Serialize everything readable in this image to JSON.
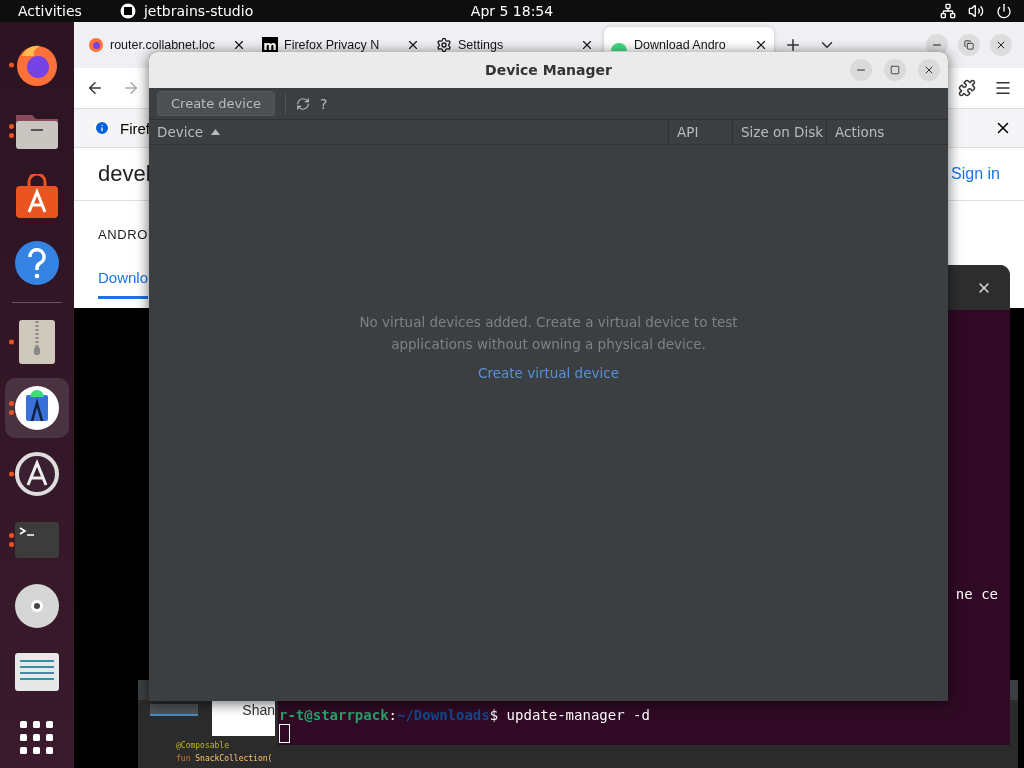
{
  "top_bar": {
    "activities": "Activities",
    "app_name": "jetbrains-studio",
    "clock": "Apr 5  18:54"
  },
  "dock": {
    "pinned": [
      {
        "kind": "firefox",
        "running": true,
        "multiple": false,
        "selected": false
      },
      {
        "kind": "files",
        "running": true,
        "multiple": true,
        "selected": false
      },
      {
        "kind": "store",
        "running": false,
        "multiple": false,
        "selected": false
      },
      {
        "kind": "help",
        "running": false,
        "multiple": false,
        "selected": false
      }
    ],
    "running": [
      {
        "kind": "archive",
        "running": true,
        "multiple": false,
        "selected": false
      },
      {
        "kind": "studio",
        "running": true,
        "multiple": true,
        "selected": true
      },
      {
        "kind": "updater",
        "running": true,
        "multiple": false,
        "selected": false
      },
      {
        "kind": "terminal",
        "running": true,
        "multiple": true,
        "selected": false
      },
      {
        "kind": "disc",
        "running": false,
        "multiple": false,
        "selected": false
      },
      {
        "kind": "editor",
        "running": false,
        "multiple": false,
        "selected": false
      }
    ]
  },
  "browser": {
    "tabs": [
      {
        "kind": "page",
        "label": "router.collabnet.loc",
        "selected": false
      },
      {
        "kind": "letter",
        "badge": "m",
        "label": "Firefox Privacy N",
        "selected": false
      },
      {
        "kind": "gear",
        "label": "Settings",
        "selected": false
      },
      {
        "kind": "android",
        "label": "Download Andro",
        "selected": true
      }
    ],
    "notice": "Firef",
    "page": {
      "logo": "devel",
      "sign_in": "Sign in",
      "heading": "ANDRO",
      "nav_link": "Downlo"
    }
  },
  "terminal": {
    "fragment": "ne ce",
    "prompt": "r-t@starrpack",
    "colon": ":",
    "path": "~/Downloads",
    "command": "$ update-manager -d"
  },
  "studio": {
    "preview": "Shan",
    "code": [
      {
        "kind": "annotation",
        "text": "@Composable"
      },
      {
        "kind": "function",
        "keyword": "fun",
        "text": "SnackCollection("
      }
    ]
  },
  "device_manager": {
    "title": "Device Manager",
    "create_button": "Create device",
    "help": "?",
    "columns": [
      {
        "label": "Device",
        "sorted": true
      },
      {
        "label": "API",
        "sorted": false
      },
      {
        "label": "Size on Disk",
        "sorted": false
      },
      {
        "label": "Actions",
        "sorted": false
      }
    ],
    "empty_message": "No virtual devices added. Create a virtual device to test applications without owning a physical device.",
    "create_link": "Create virtual device"
  }
}
